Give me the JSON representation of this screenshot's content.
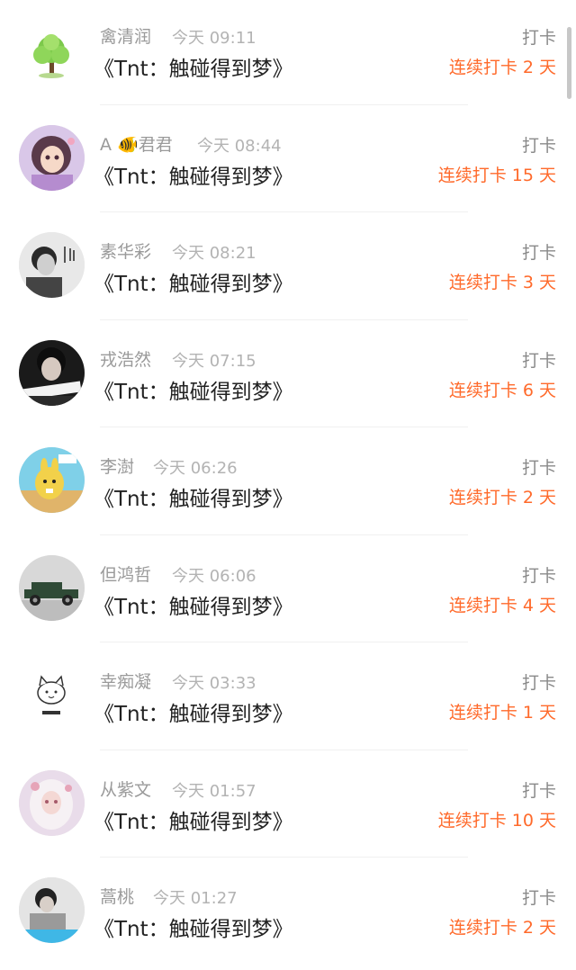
{
  "list": {
    "items": [
      {
        "name": "禽清润",
        "time": "今天 09:11",
        "title": "《Tnt：触碰得到梦》",
        "action": "打卡",
        "streak": "连续打卡 2 天",
        "avatar": "tree-avatar"
      },
      {
        "name": "A 🐠君君",
        "time": "今天 08:44",
        "title": "《Tnt：触碰得到梦》",
        "action": "打卡",
        "streak": "连续打卡 15 天",
        "avatar": "anime-girl-avatar"
      },
      {
        "name": "素华彩",
        "time": "今天 08:21",
        "title": "《Tnt：触碰得到梦》",
        "action": "打卡",
        "streak": "连续打卡 3 天",
        "avatar": "bw-portrait-avatar"
      },
      {
        "name": "戎浩然",
        "time": "今天 07:15",
        "title": "《Tnt：触碰得到梦》",
        "action": "打卡",
        "streak": "连续打卡 6 天",
        "avatar": "dark-portrait-avatar"
      },
      {
        "name": "李澍",
        "time": "今天 06:26",
        "title": "《Tnt：触碰得到梦》",
        "action": "打卡",
        "streak": "连续打卡 2 天",
        "avatar": "cartoon-avatar"
      },
      {
        "name": "但鸿哲",
        "time": "今天 06:06",
        "title": "《Tnt：触碰得到梦》",
        "action": "打卡",
        "streak": "连续打卡 4 天",
        "avatar": "vintage-car-avatar"
      },
      {
        "name": "幸痴凝",
        "time": "今天 03:33",
        "title": "《Tnt：触碰得到梦》",
        "action": "打卡",
        "streak": "连续打卡 1 天",
        "avatar": "cat-sketch-avatar"
      },
      {
        "name": "从紫文",
        "time": "今天 01:57",
        "title": "《Tnt：触碰得到梦》",
        "action": "打卡",
        "streak": "连续打卡 10 天",
        "avatar": "white-hair-girl-avatar"
      },
      {
        "name": "蒿桃",
        "time": "今天 01:27",
        "title": "《Tnt：触碰得到梦》",
        "action": "打卡",
        "streak": "连续打卡 2 天",
        "avatar": "photo-avatar"
      }
    ]
  },
  "colors": {
    "accent": "#ff6a2b",
    "name": "#9a9a9a",
    "title": "#222222",
    "action": "#8a8a8a"
  }
}
